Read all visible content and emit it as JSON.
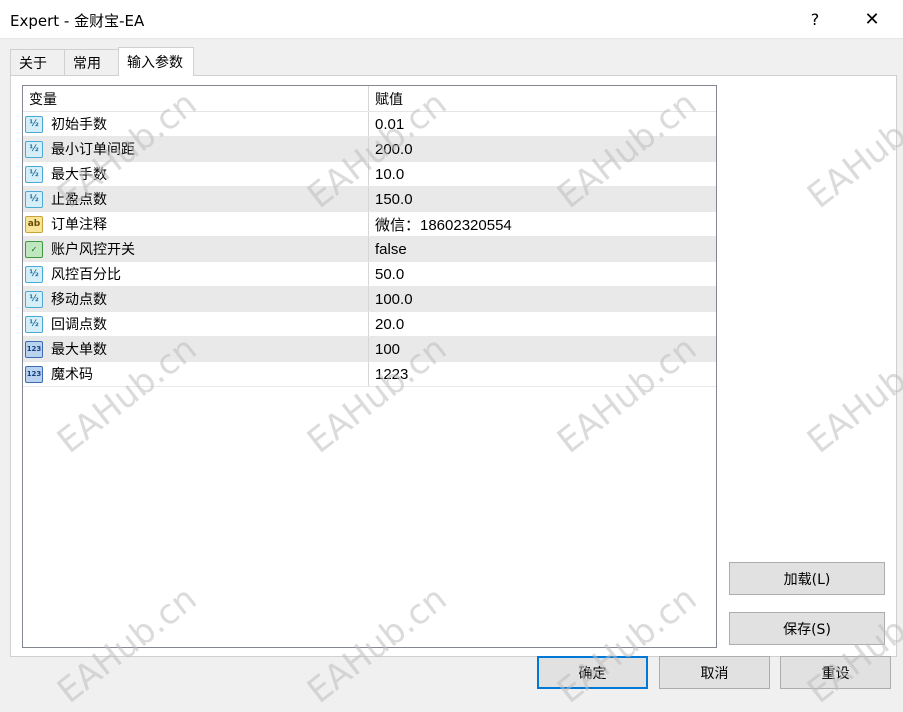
{
  "window": {
    "title": "Expert - 金财宝-EA",
    "help_label": "?",
    "close_label": "✕"
  },
  "tabs": [
    {
      "label": "关于"
    },
    {
      "label": "常用"
    },
    {
      "label": "输入参数"
    }
  ],
  "table": {
    "headers": {
      "variable": "变量",
      "value": "赋值"
    },
    "rows": [
      {
        "type": "double",
        "name": "初始手数",
        "value": "0.01"
      },
      {
        "type": "double",
        "name": "最小订单间距",
        "value": "200.0"
      },
      {
        "type": "double",
        "name": "最大手数",
        "value": "10.0"
      },
      {
        "type": "double",
        "name": "止盈点数",
        "value": "150.0"
      },
      {
        "type": "string",
        "name": "订单注释",
        "value": "微信：18602320554"
      },
      {
        "type": "bool",
        "name": "账户风控开关",
        "value": "false"
      },
      {
        "type": "double",
        "name": "风控百分比",
        "value": "50.0"
      },
      {
        "type": "double",
        "name": "移动点数",
        "value": "100.0"
      },
      {
        "type": "double",
        "name": "回调点数",
        "value": "20.0"
      },
      {
        "type": "int",
        "name": "最大单数",
        "value": "100"
      },
      {
        "type": "int",
        "name": "魔术码",
        "value": "1223"
      }
    ]
  },
  "icons": {
    "double": "½",
    "string": "ab",
    "bool": "✓",
    "int": "123"
  },
  "buttons": {
    "load": "加载(L)",
    "save": "保存(S)",
    "ok": "确定",
    "cancel": "取消",
    "reset": "重设"
  },
  "watermark": "EAHub.cn"
}
